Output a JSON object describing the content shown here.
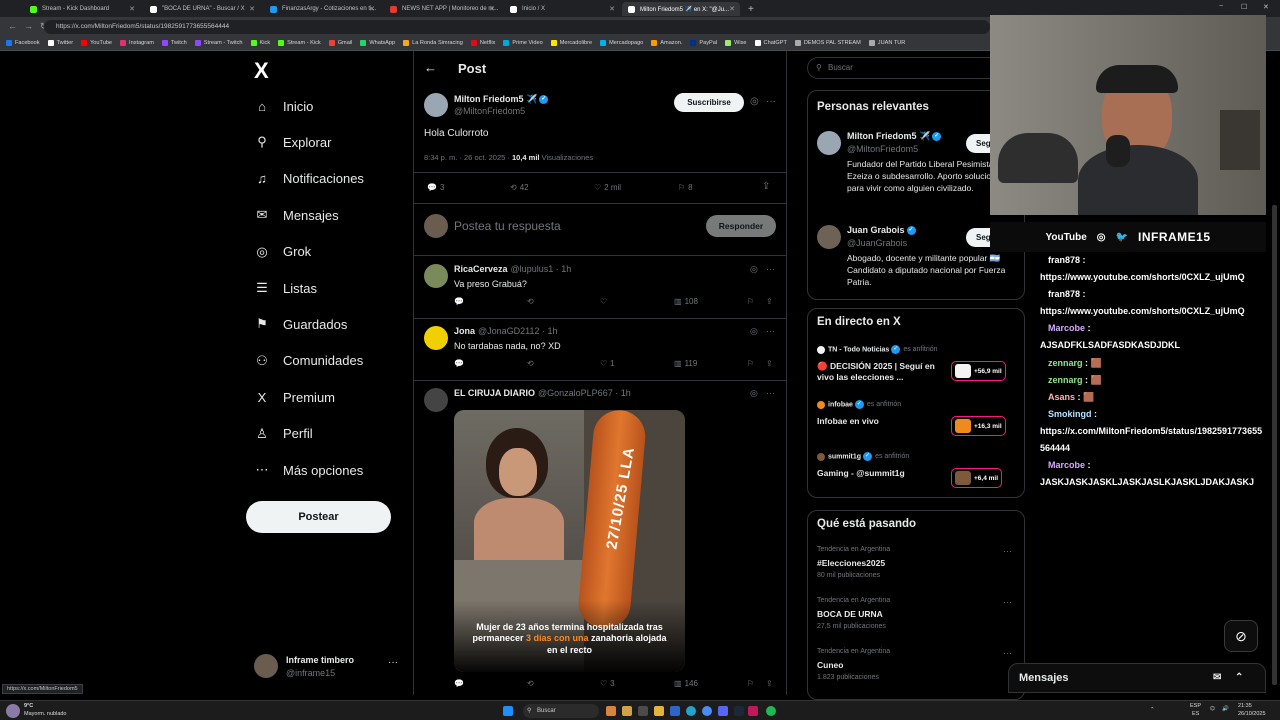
{
  "browser": {
    "tabs": [
      {
        "label": "Stream - Kick Dashboard",
        "color": "#53fc18"
      },
      {
        "label": "\"BOCA DE URNA\" - Buscar / X",
        "color": "#ffffff"
      },
      {
        "label": "FinanzasArgy - Cotizaciones en ti...",
        "color": "#1d9bf0"
      },
      {
        "label": "NEWS NET APP | Monitoreo de m...",
        "color": "#e53935"
      },
      {
        "label": "Inicio / X",
        "color": "#ffffff"
      },
      {
        "label": "Milton Friedom5 ✈️ en X: \"@Ju...",
        "color": "#ffffff"
      }
    ],
    "new_tab": "+",
    "window_controls": [
      "−",
      "☐",
      "✕"
    ],
    "url": "https://x.com/MiltonFriedom5/status/1982591773655564444",
    "bookmarks": [
      {
        "label": "Facebook",
        "color": "#1877f2"
      },
      {
        "label": "Twitter",
        "color": "#ffffff"
      },
      {
        "label": "YouTube",
        "color": "#ff0000"
      },
      {
        "label": "Instagram",
        "color": "#e1306c"
      },
      {
        "label": "Twitch",
        "color": "#9146ff"
      },
      {
        "label": "Stream - Twitch",
        "color": "#9146ff"
      },
      {
        "label": "Kick",
        "color": "#53fc18"
      },
      {
        "label": "Stream - Kick",
        "color": "#53fc18"
      },
      {
        "label": "Gmail",
        "color": "#ea4335"
      },
      {
        "label": "WhatsApp",
        "color": "#25d366"
      },
      {
        "label": "La Ronda Simracing",
        "color": "#f5a623"
      },
      {
        "label": "Netflix",
        "color": "#e50914"
      },
      {
        "label": "Prime Video",
        "color": "#00a8e1"
      },
      {
        "label": "Mercadolibre",
        "color": "#ffe600"
      },
      {
        "label": "Mercadopago",
        "color": "#00b1ea"
      },
      {
        "label": "Amazon.",
        "color": "#ff9900"
      },
      {
        "label": "PayPal",
        "color": "#003087"
      },
      {
        "label": "Wise",
        "color": "#9fe870"
      },
      {
        "label": "ChatGPT",
        "color": "#ffffff"
      },
      {
        "label": "DEMOS PAL STREAM",
        "color": "#aaaaaa"
      },
      {
        "label": "JUAN TUR",
        "color": "#aaaaaa"
      }
    ],
    "status_url": "https://x.com/MiltonFriedom5"
  },
  "sidebar": {
    "logo": "X",
    "items": [
      {
        "label": "Inicio",
        "icon": "⌂"
      },
      {
        "label": "Explorar",
        "icon": "⚲"
      },
      {
        "label": "Notificaciones",
        "icon": "♫"
      },
      {
        "label": "Mensajes",
        "icon": "✉"
      },
      {
        "label": "Grok",
        "icon": "◎"
      },
      {
        "label": "Listas",
        "icon": "☰"
      },
      {
        "label": "Guardados",
        "icon": "⚑"
      },
      {
        "label": "Comunidades",
        "icon": "⚇"
      },
      {
        "label": "Premium",
        "icon": "X"
      },
      {
        "label": "Perfil",
        "icon": "♙"
      },
      {
        "label": "Más opciones",
        "icon": "⋯"
      }
    ],
    "post_button": "Postear",
    "account": {
      "name": "Inframe timbero",
      "handle": "@inframe15",
      "more": "···"
    }
  },
  "post": {
    "header_title": "Post",
    "back": "←",
    "author_name": "Milton Friedom5 ✈️",
    "author_handle": "@MiltonFriedom5",
    "subscribe": "Suscribirse",
    "text": "Hola Culorroto",
    "timestamp": "8:34 p. m. · 26 oct. 2025 ·",
    "views_count": "10,4 mil",
    "views_label": "Visualizaciones",
    "stats": {
      "replies": "3",
      "reposts": "42",
      "likes": "2 mil",
      "bookmarks": "8"
    },
    "reply_placeholder": "Postea tu respuesta",
    "reply_button": "Responder"
  },
  "replies": [
    {
      "name": "RicaCerveza",
      "handle": "@lupulus1 · 1h",
      "text": "Va preso Grabuá?",
      "views": "108",
      "replies": "",
      "likes": "",
      "reposts": ""
    },
    {
      "name": "Jona",
      "handle": "@JonaGD2112 · 1h",
      "text": "No tardabas nada, no? XD",
      "views": "119",
      "replies": "",
      "likes": "1",
      "reposts": ""
    },
    {
      "name": "EL CIRUJA DIARIO",
      "handle": "@GonzaloPLP667 · 1h",
      "text": "",
      "views": "146",
      "replies": "",
      "likes": "3",
      "reposts": "",
      "image_caption_a": "Mujer de 23 años termina hospitalizada tras permanecer ",
      "image_caption_hl": "3 días con una",
      "image_caption_b": " zanahoria alojada en el recto",
      "image_stamp": "27/10/25 LLA"
    }
  ],
  "right": {
    "search_placeholder": "Buscar",
    "relevant_title": "Personas relevantes",
    "people": [
      {
        "name": "Milton Friedom5 ✈️",
        "handle": "@MiltonFriedom5",
        "bio": "Fundador del Partido Liberal Pesimista. Ezeiza o subdesarrollo. Aporto soluciones para vivir como alguien civilizado.",
        "follow": "Seguir"
      },
      {
        "name": "Juan Grabois",
        "handle": "@JuanGrabois",
        "bio": "Abogado, docente y militante popular 🇦🇷 Candidato a diputado nacional por Fuerza Patria.",
        "follow": "Seguir"
      }
    ],
    "live_title": "En directo en X",
    "lives": [
      {
        "host": "TN - Todo Noticias",
        "host_suffix": "es anfitrión",
        "title": "🔴 DECISIÓN 2025 | Seguí en vivo las elecciones ...",
        "count": "+56,9 mil"
      },
      {
        "host": "infobae",
        "host_suffix": "es anfitrión",
        "title": "Infobae en vivo",
        "count": "+16,3 mil"
      },
      {
        "host": "summit1g",
        "host_suffix": "es anfitrión",
        "title": "Gaming - @summit1g",
        "count": "+6,4 mil"
      }
    ],
    "trends_title": "Qué está pasando",
    "trends": [
      {
        "context": "Tendencia en Argentina",
        "name": "#Elecciones2025",
        "count": "80 mil publicaciones"
      },
      {
        "context": "Tendencia en Argentina",
        "name": "BOCA DE URNA",
        "count": "27,5 mil publicaciones"
      },
      {
        "context": "Tendencia en Argentina",
        "name": "Cuneo",
        "count": "1.823 publicaciones"
      }
    ],
    "messages": "Mensajes"
  },
  "stream": {
    "overlay_brand": "YouTube",
    "overlay_name": "INFRAME15",
    "chat": [
      {
        "user": "fran878",
        "text": "https://www.youtube.com/shorts/0CXLZ_ujUmQ"
      },
      {
        "user": "fran878",
        "text": "https://www.youtube.com/shorts/0CXLZ_ujUmQ"
      },
      {
        "user": "Marcobe",
        "text": "AJSADFKLSADFASDKASDJDKL"
      },
      {
        "user": "zennarg",
        "text": "🟫"
      },
      {
        "user": "zennarg",
        "text": "🟫"
      },
      {
        "user": "Asans",
        "text": "🟫"
      },
      {
        "user": "Smokingd",
        "text": "https://x.com/MiltonFriedom5/status/1982591773655564444"
      },
      {
        "user": "Marcobe",
        "text": "JASKJASKJASKLJASKJASLKJASKLJDAKJASKJ"
      }
    ]
  },
  "taskbar": {
    "weather_temp": "9°C",
    "weather_desc": "Mayorm. nublado",
    "search": "Buscar",
    "lang": "ESP",
    "lang2": "ES",
    "time": "21:35",
    "date": "26/10/2025"
  }
}
